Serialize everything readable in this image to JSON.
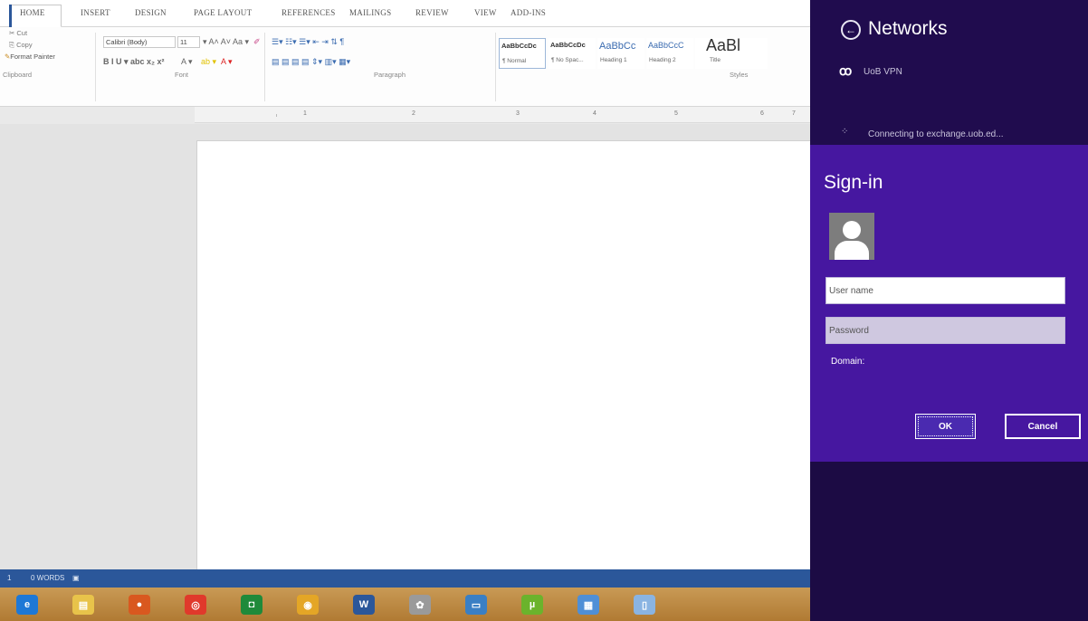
{
  "word": {
    "tabs": [
      "HOME",
      "INSERT",
      "DESIGN",
      "PAGE LAYOUT",
      "REFERENCES",
      "MAILINGS",
      "REVIEW",
      "VIEW",
      "ADD-INS"
    ],
    "clipboard": {
      "cut": "Cut",
      "copy": "Copy",
      "format_painter": "Format Painter",
      "group": "Clipboard"
    },
    "font": {
      "name": "Calibri (Body)",
      "size": "11",
      "group": "Font"
    },
    "paragraph_group": "Paragraph",
    "styles": {
      "group": "Styles",
      "items": [
        {
          "sample": "AaBbCcDc",
          "name": "¶ Normal"
        },
        {
          "sample": "AaBbCcDc",
          "name": "¶ No Spac..."
        },
        {
          "sample": "AaBbCc",
          "name": "Heading 1"
        },
        {
          "sample": "AaBbCcC",
          "name": "Heading 2"
        },
        {
          "sample": "AaBl",
          "name": "Title"
        }
      ]
    },
    "ruler": [
      "1",
      "2",
      "3",
      "4",
      "5",
      "6",
      "7"
    ],
    "status": {
      "page": "1",
      "words": "0 WORDS"
    }
  },
  "taskbar": {
    "apps": [
      {
        "icon": "internet-explorer-icon",
        "color": "#1e78d6",
        "glyph": "e"
      },
      {
        "icon": "file-explorer-icon",
        "color": "#e8c34a",
        "glyph": "▤"
      },
      {
        "icon": "firefox-icon",
        "color": "#d9581f",
        "glyph": "●"
      },
      {
        "icon": "app-red-icon",
        "color": "#e0392b",
        "glyph": "◎"
      },
      {
        "icon": "app-green-icon",
        "color": "#1f8a3a",
        "glyph": "◘"
      },
      {
        "icon": "chrome-icon",
        "color": "#e4a626",
        "glyph": "◉"
      },
      {
        "icon": "word-icon",
        "color": "#2b579a",
        "glyph": "W"
      },
      {
        "icon": "app-gray-icon",
        "color": "#9a9a9a",
        "glyph": "✿"
      },
      {
        "icon": "remote-desktop-icon",
        "color": "#3a7fc4",
        "glyph": "▭"
      },
      {
        "icon": "utorrent-icon",
        "color": "#6bb32c",
        "glyph": "µ"
      },
      {
        "icon": "app-blue-icon",
        "color": "#4f8fd6",
        "glyph": "▦"
      },
      {
        "icon": "app-light-icon",
        "color": "#8ab4e2",
        "glyph": "▯"
      }
    ]
  },
  "networks": {
    "title": "Networks",
    "vpn_name": "UoB VPN",
    "connecting": "Connecting to exchange.uob.ed...",
    "signin": {
      "title": "Sign-in",
      "username_placeholder": "User name",
      "password_placeholder": "Password",
      "domain_label": "Domain:",
      "ok": "OK",
      "cancel": "Cancel"
    }
  }
}
